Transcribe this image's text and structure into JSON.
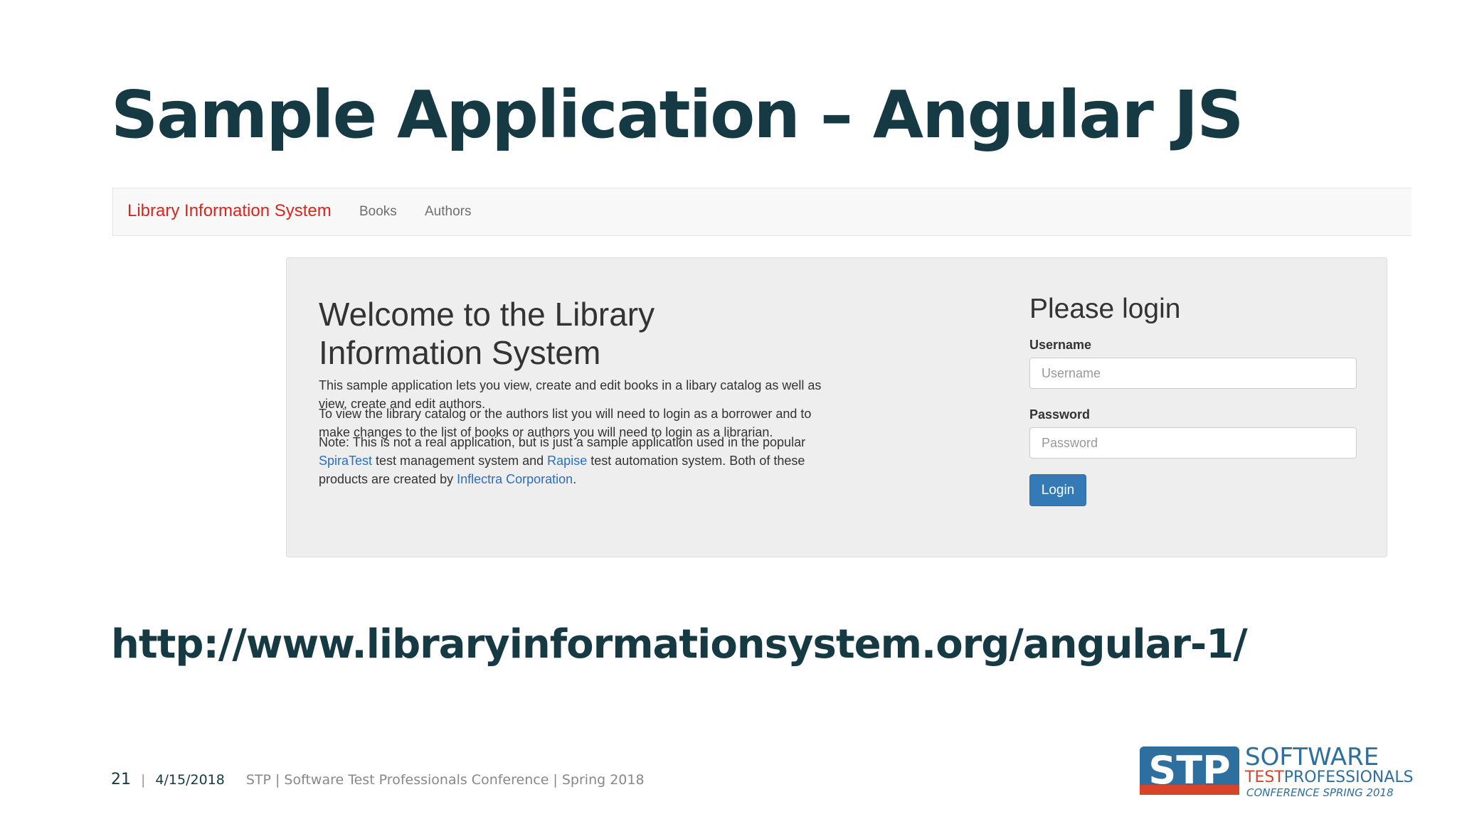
{
  "slide": {
    "title": "Sample Application – Angular JS",
    "url": "http://www.libraryinformationsystem.org/angular-1/"
  },
  "app": {
    "brand": "Library Information System",
    "nav": [
      {
        "label": "Books"
      },
      {
        "label": "Authors"
      }
    ],
    "welcome": {
      "title": "Welcome to the Library Information System",
      "para1": "This sample application lets you view, create and edit books in a libary catalog as well as view, create and edit authors.",
      "para2": "To view the library catalog or the authors list you will need to login as a borrower and to make changes to the list of books or authors you will need to login as a librarian.",
      "para3_part1": "Note: This is not a real application, but is just a sample application used in the popular ",
      "para3_link1": "SpiraTest",
      "para3_part2": " test management system and ",
      "para3_link2": "Rapise",
      "para3_part3": " test automation system. Both of these products are created by ",
      "para3_link3": "Inflectra Corporation",
      "para3_part4": "."
    },
    "login": {
      "title": "Please login",
      "username_label": "Username",
      "username_placeholder": "Username",
      "username_value": "",
      "password_label": "Password",
      "password_placeholder": "Password",
      "password_value": "",
      "button": "Login"
    }
  },
  "footer": {
    "page_number": "21",
    "separator": "|",
    "date": "4/15/2018",
    "conference": "STP | Software Test Professionals Conference | Spring 2018"
  },
  "logo": {
    "mark": "STP",
    "line1": "SOFTWARE",
    "line2_a": "TEST",
    "line2_b": "PROFESSIONALS",
    "line3": "CONFERENCE SPRING 2018"
  },
  "colors": {
    "title": "#163a44",
    "brand": "#d9261c",
    "link": "#2a6fbf",
    "button": "#337ab7",
    "logo_blue": "#2d6f9e",
    "logo_red": "#d9432c"
  }
}
